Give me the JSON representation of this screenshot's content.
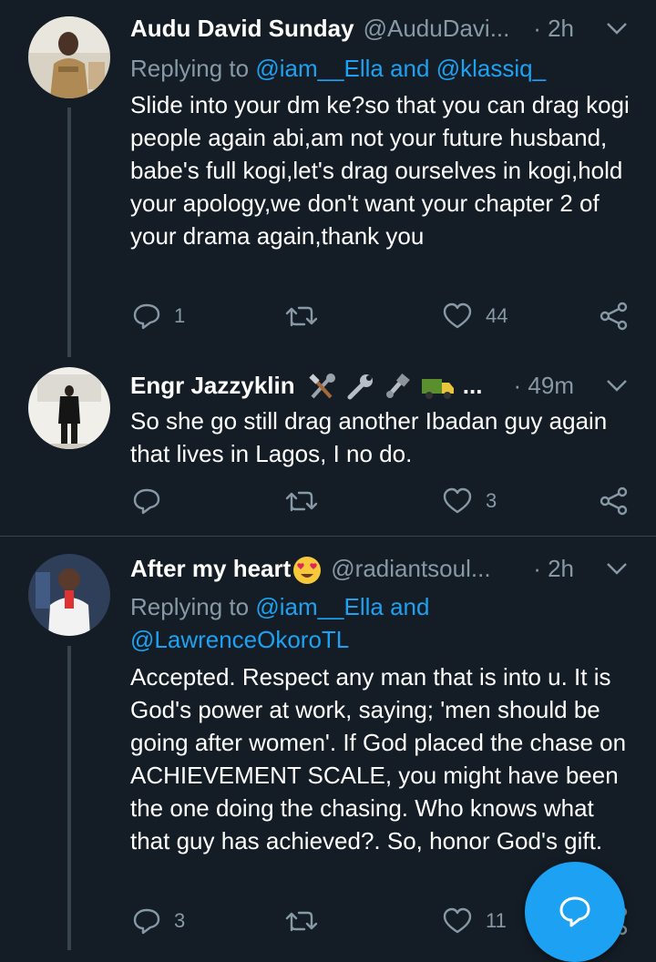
{
  "tweets": [
    {
      "name": "Audu David Sunday",
      "handle": "@AuduDavi...",
      "time": "· 2h",
      "replying_prefix": "Replying to ",
      "replying_links": "@iam__Ella and @klassiq_",
      "body": "Slide into your dm ke?so that you can drag kogi people again abi,am not your future husband, babe's full kogi,let's drag ourselves in kogi,hold your apology,we don't want your chapter 2 of your drama again,thank you",
      "reply_count": "1",
      "retweet_count": "",
      "like_count": "44"
    },
    {
      "name": "Engr Jazzyklin",
      "handle_suffix": "...",
      "time": "· 49m",
      "body": "So she go still drag another Ibadan guy again that lives in Lagos, I no do.",
      "reply_count": "",
      "retweet_count": "",
      "like_count": "3"
    },
    {
      "name": "After my heart",
      "handle": "@radiantsoul...",
      "time": "· 2h",
      "replying_prefix": "Replying to ",
      "replying_links_1": "@iam__Ella and",
      "replying_links_2": "@LawrenceOkoroTL",
      "body": "Accepted. Respect any man that is into u. It is God's power at work, saying; 'men should be going after women'. If God placed the chase on ACHIEVEMENT SCALE, you might have been the one doing the chasing. Who knows what that guy has achieved?. So, honor God's gift.",
      "reply_count": "3",
      "retweet_count": "",
      "like_count": "11"
    }
  ],
  "colors": {
    "background": "#141d26",
    "muted": "#8899a6",
    "link": "#1da1f2",
    "divider": "#38444d"
  },
  "icons": [
    "reply-icon",
    "retweet-icon",
    "like-icon",
    "share-icon",
    "chevron-down-icon",
    "compose-icon"
  ]
}
